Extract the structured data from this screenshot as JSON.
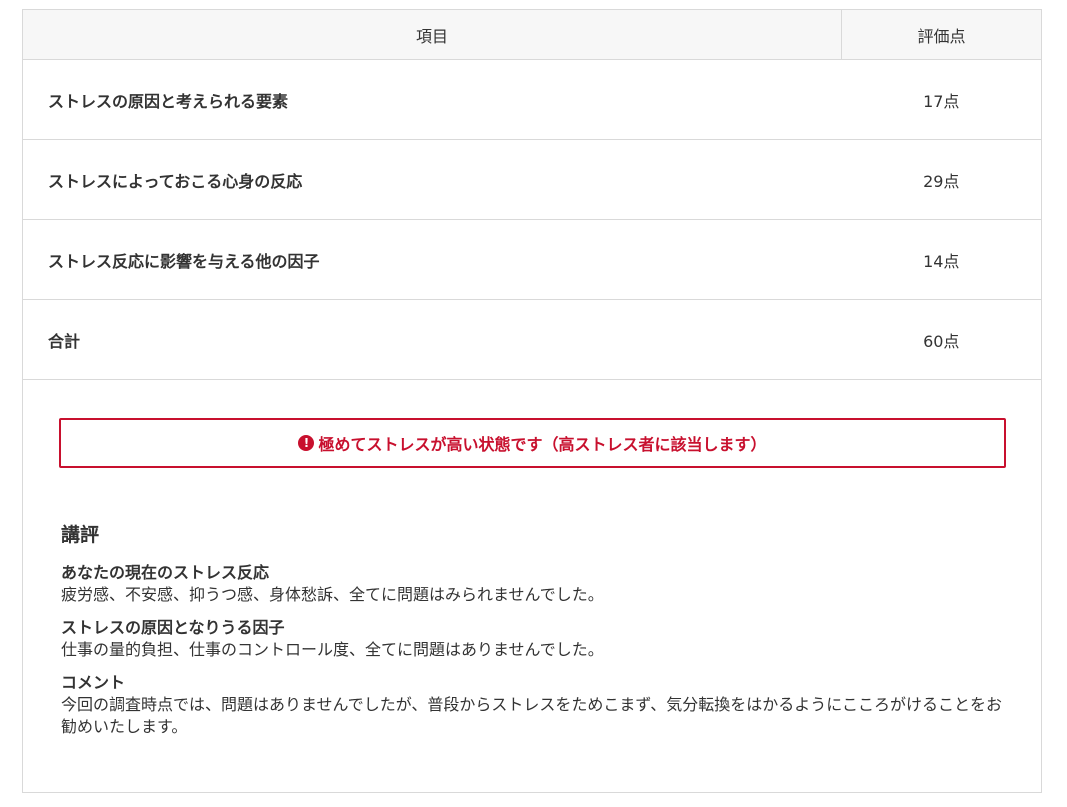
{
  "table": {
    "headers": {
      "item": "項目",
      "score": "評価点"
    },
    "rows": [
      {
        "label": "ストレスの原因と考えられる要素",
        "value": "17点"
      },
      {
        "label": "ストレスによっておこる心身の反応",
        "value": "29点"
      },
      {
        "label": "ストレス反応に影響を与える他の因子",
        "value": "14点"
      },
      {
        "label": "合計",
        "value": "60点"
      }
    ]
  },
  "alert": {
    "icon": "exclamation-circle-icon",
    "icon_glyph": "!",
    "text": "極めてストレスが高い状態です（高ストレス者に該当します）",
    "color": "#c8102e"
  },
  "review": {
    "title": "講評",
    "sections": [
      {
        "title": "あなたの現在のストレス反応",
        "text": "疲労感、不安感、抑うつ感、身体愁訴、全てに問題はみられませんでした。"
      },
      {
        "title": "ストレスの原因となりうる因子",
        "text": "仕事の量的負担、仕事のコントロール度、全てに問題はありませんでした。"
      },
      {
        "title": "コメント",
        "text": "今回の調査時点では、問題はありませんでしたが、普段からストレスをためこまず、気分転換をはかるようにこころがけることをお勧めいたします。"
      }
    ]
  }
}
